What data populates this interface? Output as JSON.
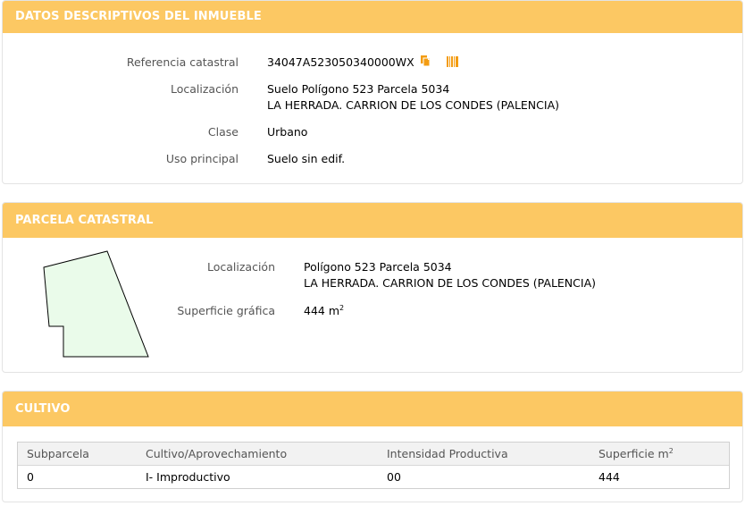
{
  "datos": {
    "header": "DATOS DESCRIPTIVOS DEL INMUEBLE",
    "ref_label": "Referencia catastral",
    "ref_value": "34047A523050340000WX",
    "loc_label": "Localización",
    "loc_line1": "Suelo Polígono 523 Parcela 5034",
    "loc_line2": "LA HERRADA. CARRION DE LOS CONDES (PALENCIA)",
    "clase_label": "Clase",
    "clase_value": "Urbano",
    "uso_label": "Uso principal",
    "uso_value": "Suelo sin edif."
  },
  "parcela": {
    "header": "PARCELA CATASTRAL",
    "loc_label": "Localización",
    "loc_line1": "Polígono 523 Parcela 5034",
    "loc_line2": "LA HERRADA. CARRION DE LOS CONDES (PALENCIA)",
    "sup_label": "Superficie gráfica",
    "sup_value": "444 m",
    "sup_exp": "2"
  },
  "cultivo": {
    "header": "CULTIVO",
    "columns": [
      "Subparcela",
      "Cultivo/Aprovechamiento",
      "Intensidad Productiva",
      "Superficie m"
    ],
    "col_exp": "2",
    "rows": [
      [
        "0",
        "I- Improductivo",
        "00",
        "444"
      ]
    ]
  },
  "colors": {
    "header_bg": "#fcc863",
    "icon_orange": "#f39c12",
    "parcel_fill": "#eafbea"
  },
  "icons": [
    "copy-icon",
    "barcode-icon"
  ]
}
